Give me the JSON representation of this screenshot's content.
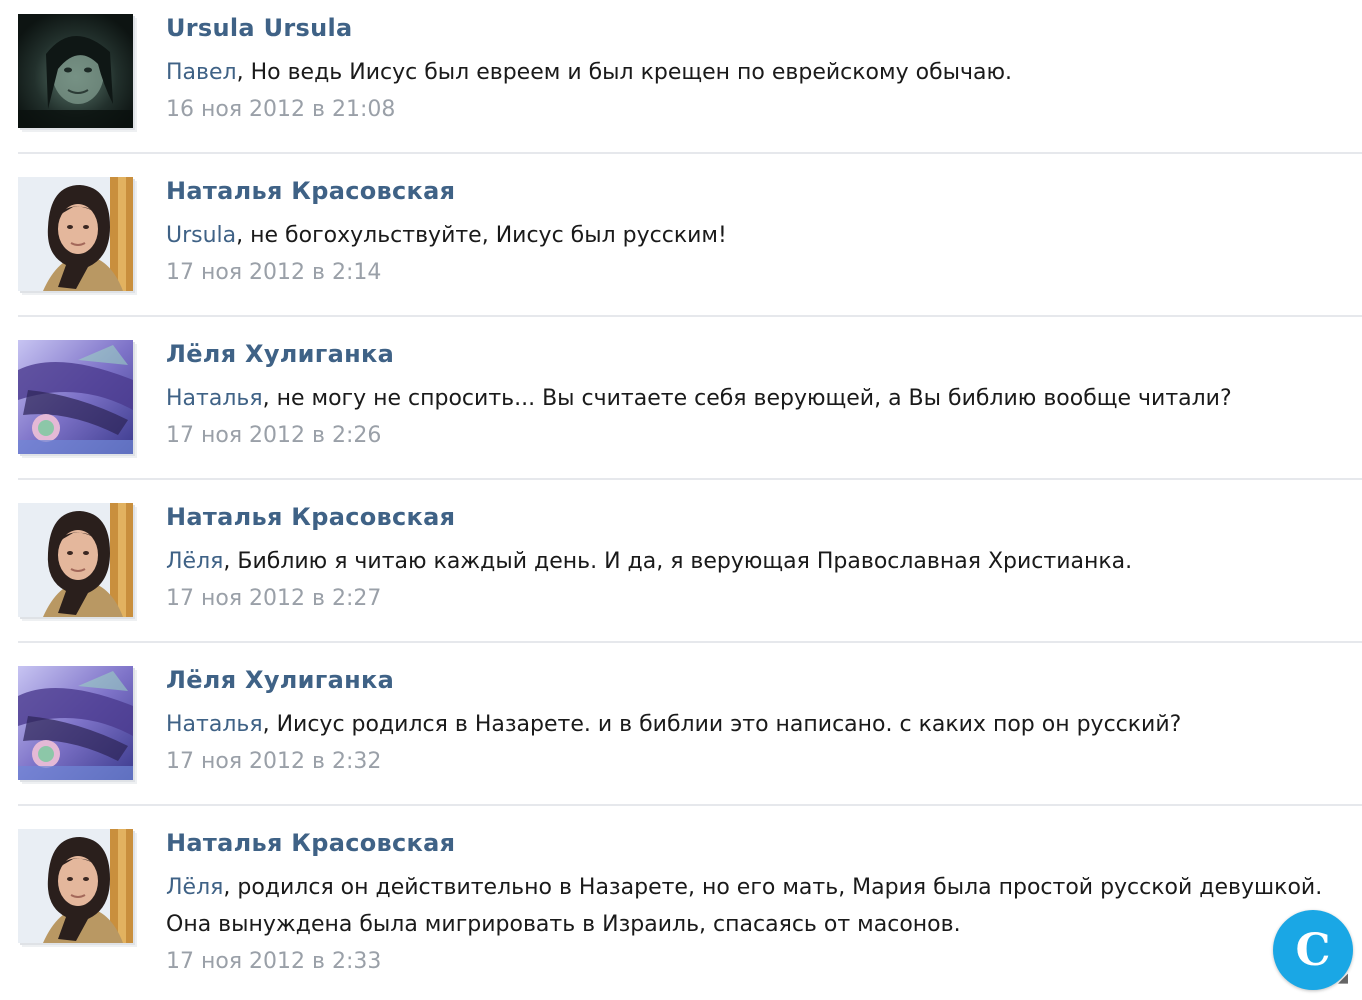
{
  "comments": [
    {
      "author": "Ursula Ursula",
      "avatar_icon": "dark-portrait-avatar",
      "mention": "Павел",
      "text": ", Но ведь Иисус был евреем и был крещен по еврейскому обычаю.",
      "date": "16 ноя 2012 в 21:08"
    },
    {
      "author": "Наталья Красовская",
      "avatar_icon": "woman-portrait-avatar",
      "mention": "Ursula",
      "text": ", не богохульствуйте, Иисус был русским!",
      "date": "17 ноя 2012 в 2:14"
    },
    {
      "author": "Лёля Хулиганка",
      "avatar_icon": "purple-art-avatar",
      "mention": "Наталья",
      "text": ", не могу не спросить... Вы считаете себя верующей, а Вы библию вообще читали?",
      "date": "17 ноя 2012 в 2:26"
    },
    {
      "author": "Наталья Красовская",
      "avatar_icon": "woman-portrait-avatar",
      "mention": "Лёля",
      "text": ", Библию я читаю каждый день. И да, я верующая Православная Христианка.",
      "date": "17 ноя 2012 в 2:27"
    },
    {
      "author": "Лёля Хулиганка",
      "avatar_icon": "purple-art-avatar",
      "mention": "Наталья",
      "text": ", Иисус родился в Назарете. и в библии это написано. с каких пор он русский?",
      "date": "17 ноя 2012 в 2:32"
    },
    {
      "author": "Наталья Красовская",
      "avatar_icon": "woman-portrait-avatar",
      "mention": "Лёля",
      "text": ", родился он действительно в Назарете, но его мать, Мария была простой русской девушкой.",
      "text_line2": "Она вынуждена была мигрировать в Израиль, спасаясь от масонов.",
      "date": "17 ноя 2012 в 2:33"
    }
  ],
  "badge": {
    "letter": "C",
    "color": "#1aa7e5"
  },
  "colors": {
    "link": "#3f6286",
    "text": "#1a1a1a",
    "date": "#9aa0a8",
    "divider": "#e6e8ec"
  }
}
